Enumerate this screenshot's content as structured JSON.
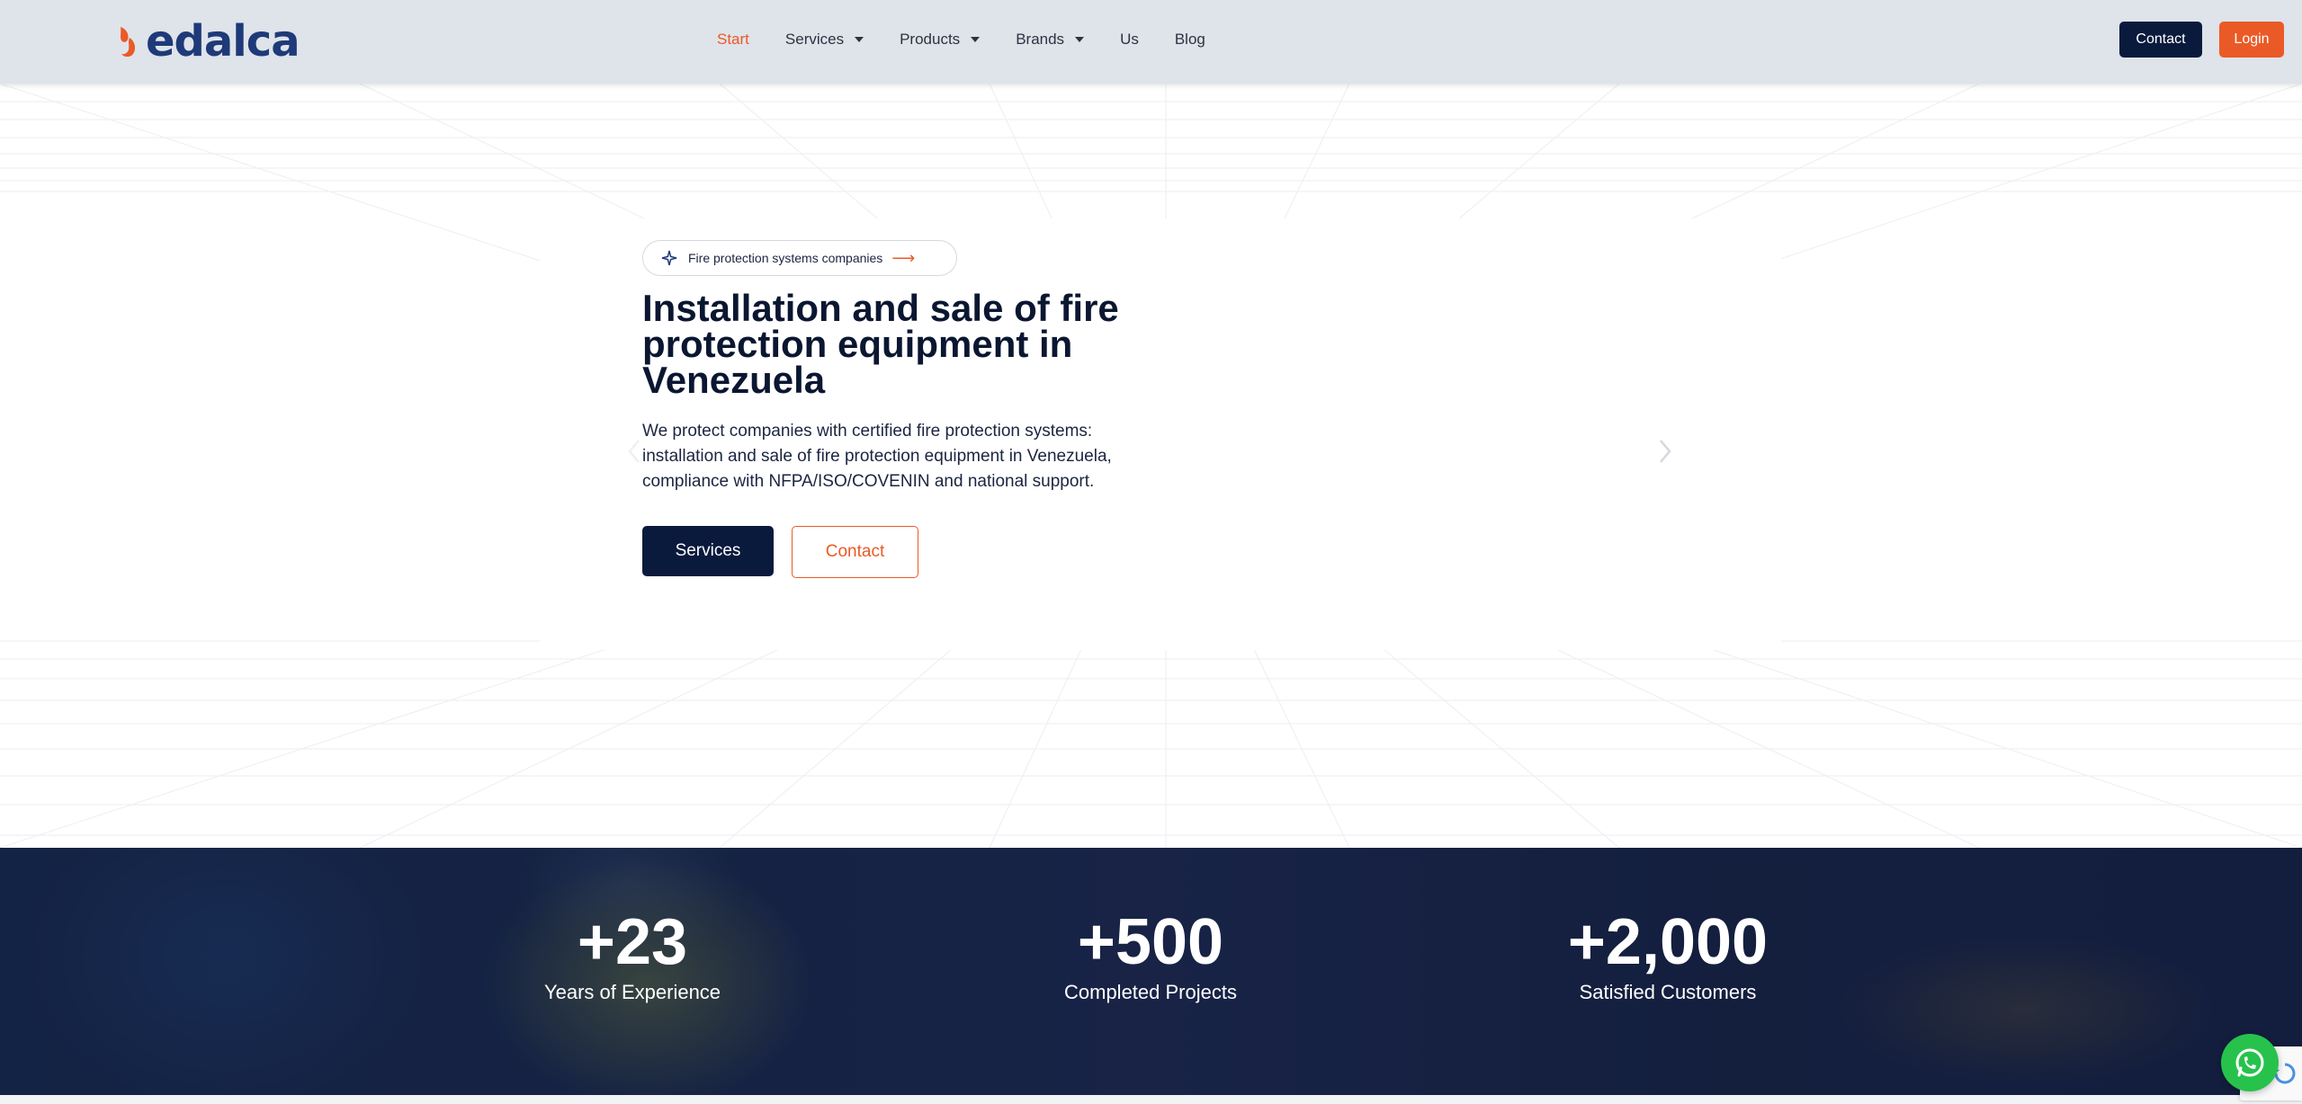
{
  "brand": {
    "name": "edalca",
    "logo_color": "#1e3a78",
    "mark_color": "#ea5a26",
    "logo_icon": "edalca-logo-mark"
  },
  "nav": {
    "items": [
      {
        "label": "Start",
        "active": true,
        "dropdown": false
      },
      {
        "label": "Services",
        "active": false,
        "dropdown": true
      },
      {
        "label": "Products",
        "active": false,
        "dropdown": true
      },
      {
        "label": "Brands",
        "active": false,
        "dropdown": true
      },
      {
        "label": "Us",
        "active": false,
        "dropdown": false
      },
      {
        "label": "Blog",
        "active": false,
        "dropdown": false
      }
    ],
    "contact_label": "Contact",
    "login_label": "Login"
  },
  "hero": {
    "badge_text": "Fire protection systems companies",
    "badge_icon": "sparkle-icon",
    "badge_arrow": "⟶",
    "title": "Installation and sale of fire protection equipment in Venezuela",
    "description": "We protect companies with certified fire protection systems: installation and sale of fire protection equipment in Venezuela, compliance with NFPA/ISO/COVENIN and national support.",
    "primary_button": "Services",
    "secondary_button": "Contact"
  },
  "stats": [
    {
      "value": "+23",
      "label": "Years of Experience"
    },
    {
      "value": "+500",
      "label": "Completed Projects"
    },
    {
      "value": "+2,000",
      "label": "Satisfied Customers"
    }
  ],
  "colors": {
    "accent": "#ea5a26",
    "navy": "#0a1a3d",
    "header_bg": "#dfe3ea",
    "whatsapp": "#27c24c"
  },
  "floating": {
    "whatsapp_icon": "whatsapp-icon",
    "recaptcha_icon": "recaptcha-icon"
  }
}
